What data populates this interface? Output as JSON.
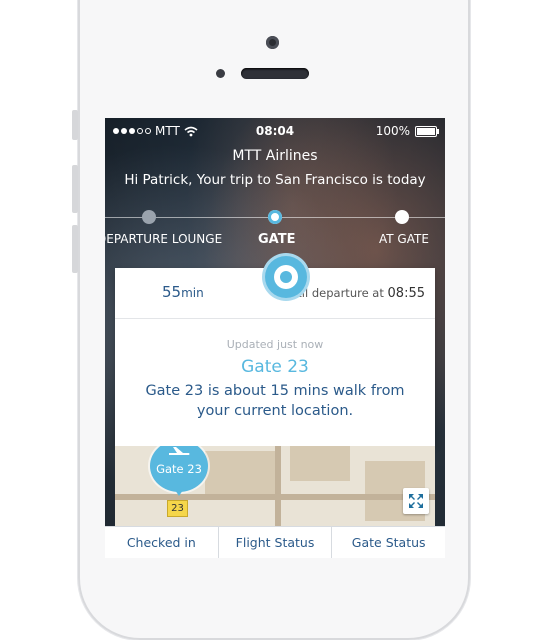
{
  "status_bar": {
    "carrier": "MTT",
    "time": "08:04",
    "battery": "100%"
  },
  "header": {
    "airline": "MTT Airlines",
    "greeting": "Hi Patrick, Your trip to San Francisco is today"
  },
  "progress": {
    "steps": [
      {
        "label": "DEPARTURE LOUNGE",
        "state": "done"
      },
      {
        "label": "GATE",
        "state": "active"
      },
      {
        "label": "AT GATE",
        "state": "upcoming"
      }
    ]
  },
  "card": {
    "minutes_value": "55",
    "minutes_unit": "min",
    "until_label": "Until departure at",
    "departure_time": "08:55",
    "updated": "Updated just now",
    "gate_title": "Gate 23",
    "gate_desc": "Gate 23 is about 15 mins walk from your current location."
  },
  "map": {
    "pin_label": "Gate 23",
    "gate_chip": "23"
  },
  "tabs": [
    {
      "label": "Checked in"
    },
    {
      "label": "Flight Status"
    },
    {
      "label": "Gate Status"
    }
  ],
  "colors": {
    "accent": "#58b8df",
    "text_dark_blue": "#2b5a8a",
    "map_bg": "#e9e3d6"
  },
  "icons": {
    "wifi": "wifi-icon",
    "battery": "battery-icon",
    "plane": "plane-icon",
    "expand": "expand-icon",
    "logo": "airline-logo"
  }
}
